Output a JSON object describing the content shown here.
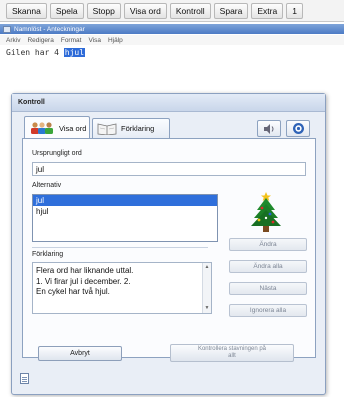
{
  "toolbar": {
    "items": [
      "Skanna",
      "Spela",
      "Stopp",
      "Visa ord",
      "Kontroll",
      "Spara",
      "Extra",
      "1"
    ]
  },
  "notepad": {
    "title": "Namnlöst - Anteckningar",
    "menu": [
      "Arkiv",
      "Redigera",
      "Format",
      "Visa",
      "Hjälp"
    ],
    "text_before": "Gilen har 4 ",
    "text_selected": "hjul"
  },
  "dialog": {
    "title": "Kontroll",
    "tabs": [
      {
        "label": "Visa ord",
        "icon": "people-icon"
      },
      {
        "label": "Förklaring",
        "icon": "book-icon"
      }
    ],
    "original_label": "Ursprungligt ord",
    "original_value": "jul",
    "alternatives_label": "Alternativ",
    "alternatives": [
      "jul",
      "hjul"
    ],
    "selected_alternative": 0,
    "picture": "christmas-tree",
    "side_buttons": [
      "Ändra",
      "Ändra alla",
      "Nästa",
      "Ignorera alla"
    ],
    "explanation_label": "Förklaring",
    "explanation_lines": [
      "Flera ord har liknande uttal.",
      "1. Vi firar jul i december. 2.",
      "En cykel har två hjul."
    ],
    "cancel": "Avbryt",
    "finish_line1": "Kontrollera stavningen på",
    "finish_line2": "allt",
    "colors": {
      "selection": "#2f6fdb",
      "accent": "#8da2c0"
    }
  }
}
